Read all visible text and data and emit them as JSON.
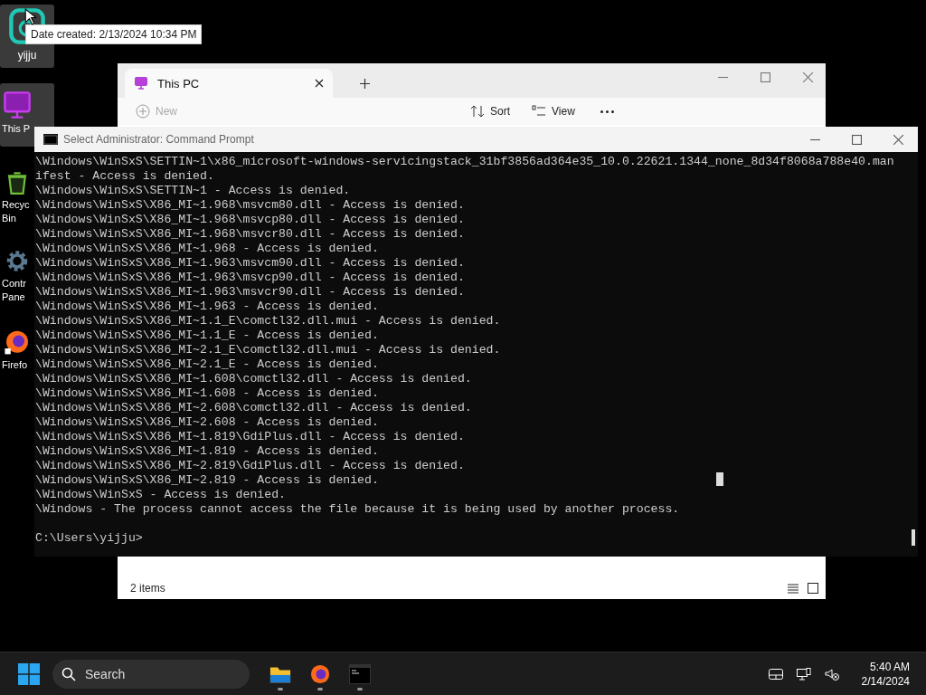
{
  "desktop_icons": [
    {
      "label": "yijju",
      "kind": "app"
    },
    {
      "label": "This P",
      "kind": "pc"
    },
    {
      "label": "Recyc\nBin",
      "kind": "bin"
    },
    {
      "label": "Contr\nPane",
      "kind": "gear"
    },
    {
      "label": "Firefo",
      "kind": "firefox"
    }
  ],
  "tooltip": "Date created: 2/13/2024 10:34 PM",
  "explorer": {
    "tab": "This PC",
    "toolbar": [
      {
        "label": "New",
        "kind": "new"
      },
      {
        "label": "Sort",
        "kind": "sort"
      },
      {
        "label": "View",
        "kind": "view"
      }
    ],
    "status": "2 items"
  },
  "cmd": {
    "title": "Select Administrator: Command Prompt",
    "lines": [
      "\\Windows\\WinSxS\\SETTIN~1\\x86_microsoft-windows-servicingstack_31bf3856ad364e35_10.0.22621.1344_none_8d34f8068a788e40.man",
      "ifest - Access is denied.",
      "\\Windows\\WinSxS\\SETTIN~1 - Access is denied.",
      "\\Windows\\WinSxS\\X86_MI~1.968\\msvcm80.dll - Access is denied.",
      "\\Windows\\WinSxS\\X86_MI~1.968\\msvcp80.dll - Access is denied.",
      "\\Windows\\WinSxS\\X86_MI~1.968\\msvcr80.dll - Access is denied.",
      "\\Windows\\WinSxS\\X86_MI~1.968 - Access is denied.",
      "\\Windows\\WinSxS\\X86_MI~1.963\\msvcm90.dll - Access is denied.",
      "\\Windows\\WinSxS\\X86_MI~1.963\\msvcp90.dll - Access is denied.",
      "\\Windows\\WinSxS\\X86_MI~1.963\\msvcr90.dll - Access is denied.",
      "\\Windows\\WinSxS\\X86_MI~1.963 - Access is denied.",
      "\\Windows\\WinSxS\\X86_MI~1.1_E\\comctl32.dll.mui - Access is denied.",
      "\\Windows\\WinSxS\\X86_MI~1.1_E - Access is denied.",
      "\\Windows\\WinSxS\\X86_MI~2.1_E\\comctl32.dll.mui - Access is denied.",
      "\\Windows\\WinSxS\\X86_MI~2.1_E - Access is denied.",
      "\\Windows\\WinSxS\\X86_MI~1.608\\comctl32.dll - Access is denied.",
      "\\Windows\\WinSxS\\X86_MI~1.608 - Access is denied.",
      "\\Windows\\WinSxS\\X86_MI~2.608\\comctl32.dll - Access is denied.",
      "\\Windows\\WinSxS\\X86_MI~2.608 - Access is denied.",
      "\\Windows\\WinSxS\\X86_MI~1.819\\GdiPlus.dll - Access is denied.",
      "\\Windows\\WinSxS\\X86_MI~1.819 - Access is denied.",
      "\\Windows\\WinSxS\\X86_MI~2.819\\GdiPlus.dll - Access is denied.",
      "\\Windows\\WinSxS\\X86_MI~2.819 - Access is denied.",
      "\\Windows\\WinSxS - Access is denied.",
      "\\Windows - The process cannot access the file because it is being used by another process."
    ],
    "prompt": "C:\\Users\\yijju>"
  },
  "taskbar": {
    "search": "Search",
    "apps": [
      {
        "kind": "folder"
      },
      {
        "kind": "firefox"
      },
      {
        "kind": "terminal"
      }
    ],
    "time": "5:40 AM",
    "date": "2/14/2024"
  }
}
